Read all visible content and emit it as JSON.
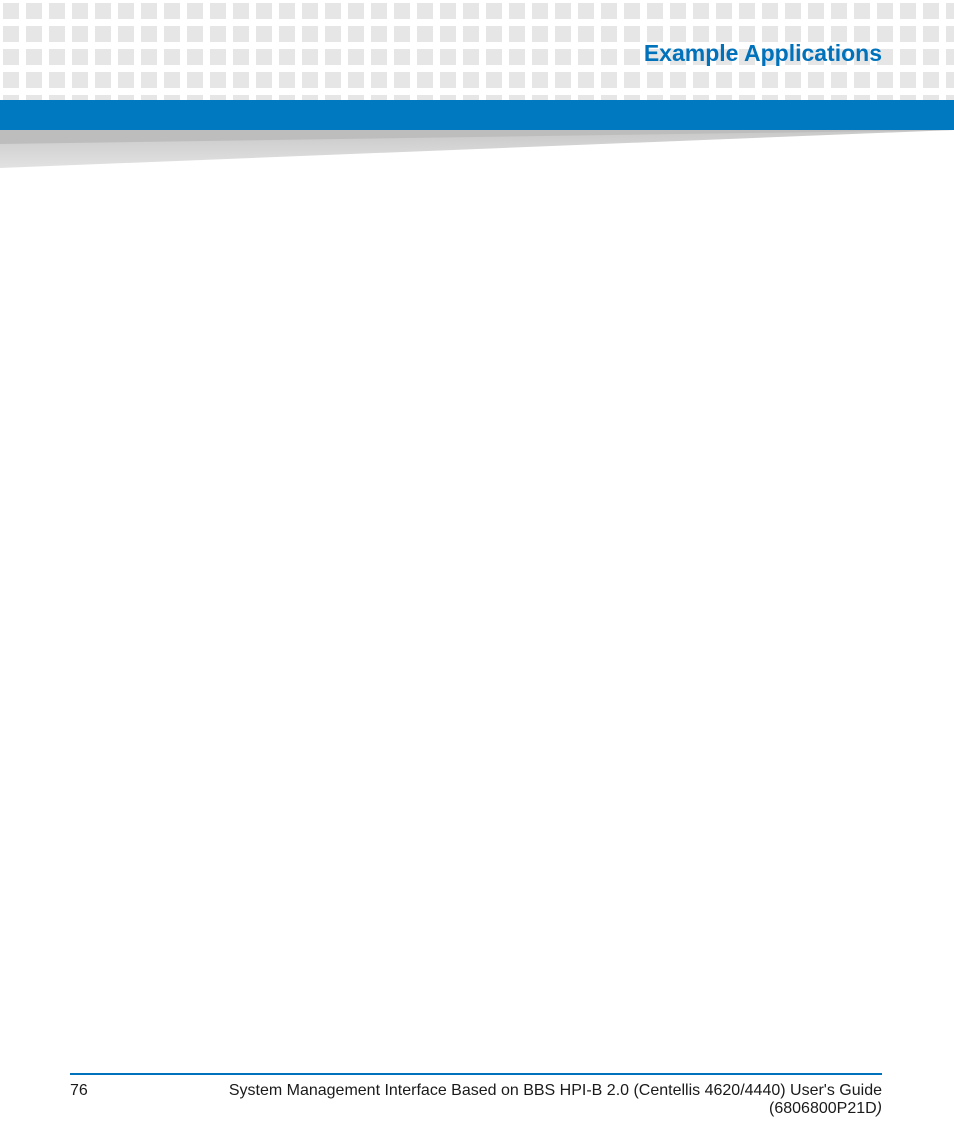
{
  "header": {
    "title": "Example Applications"
  },
  "colors": {
    "accent": "#0072bc",
    "bar": "#0079c1",
    "pattern_square": "#e6e6e6",
    "wedge_light": "#d9d9d9",
    "wedge_dark": "#bfbfbf"
  },
  "footer": {
    "page_number": "76",
    "text_main": "System Management Interface Based on BBS HPI-B 2.0 (Centellis 4620/4440) User's Guide (6806800P21D",
    "text_trail_italic": ")"
  }
}
